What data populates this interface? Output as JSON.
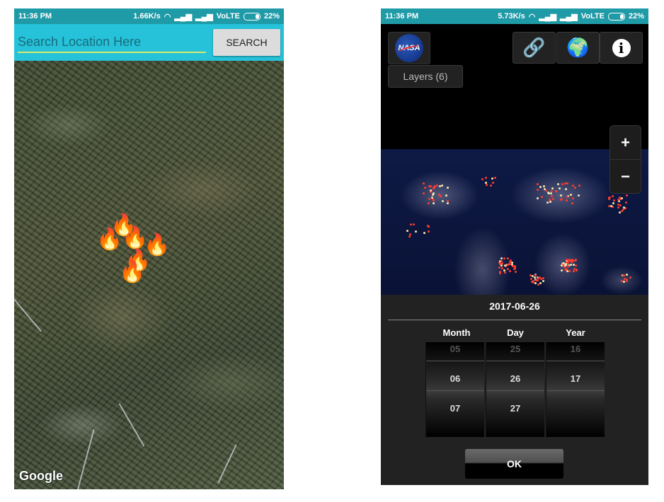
{
  "left_screen": {
    "status": {
      "time": "11:36 PM",
      "speed": "1.66K/s",
      "network": "VoLTE",
      "battery": "22%"
    },
    "search": {
      "placeholder": "Search Location Here",
      "button_label": "SEARCH"
    },
    "map": {
      "attribution": "Google",
      "fire_marker_icon": "fire-icon",
      "fire_marker_count": 6
    }
  },
  "right_screen": {
    "status": {
      "time": "11:36 PM",
      "speed": "5.73K/s",
      "network": "VoLTE",
      "battery": "22%"
    },
    "toolbar": {
      "logo_text": "NASA",
      "layers_label": "Layers (6)",
      "icons": [
        "link-icon",
        "globe-icon",
        "info-icon"
      ]
    },
    "zoom": {
      "in_label": "+",
      "out_label": "−"
    },
    "date_picker": {
      "selected_date": "2017-06-26",
      "columns": [
        {
          "header": "Month",
          "prev": "05",
          "current": "06",
          "next": "07"
        },
        {
          "header": "Day",
          "prev": "25",
          "current": "26",
          "next": "27"
        },
        {
          "header": "Year",
          "prev": "16",
          "current": "17",
          "next": ""
        }
      ],
      "ok_label": "OK"
    },
    "colors": {
      "status_bar": "#1f9aa7",
      "fire_dots": "#ff3b30"
    }
  }
}
